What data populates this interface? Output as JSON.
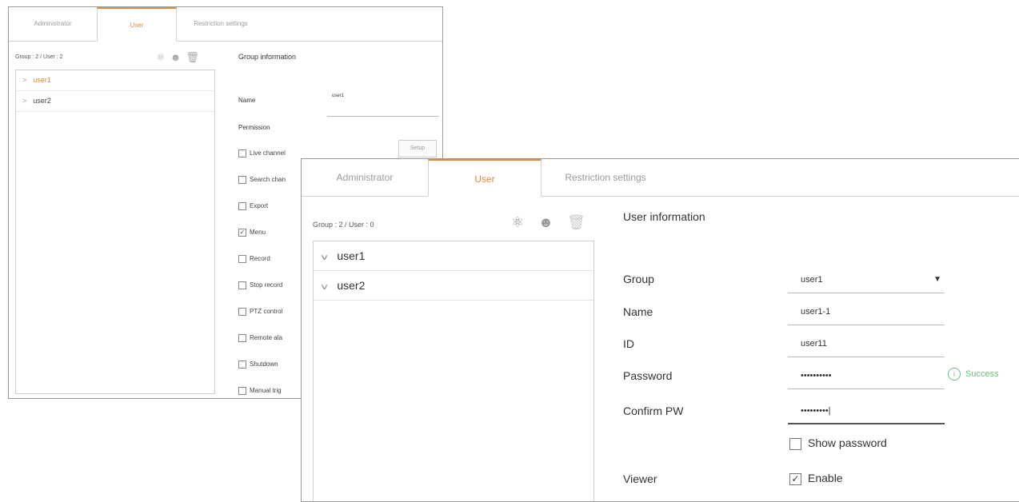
{
  "back_window": {
    "tabs": [
      "Administrator",
      "User",
      "Restriction settings"
    ],
    "counts": "Group : 2 / User : 2",
    "users": [
      "user1",
      "user2"
    ],
    "info_title": "Group information",
    "name_label": "Name",
    "name_value": "user1",
    "permission_label": "Permission",
    "setup_label": "Setup",
    "permissions": [
      {
        "label": "Live channel",
        "checked": false
      },
      {
        "label": "Search chan",
        "checked": false
      },
      {
        "label": "Export",
        "checked": false
      },
      {
        "label": "Menu",
        "checked": true
      },
      {
        "label": "Record",
        "checked": false
      },
      {
        "label": "Stop record",
        "checked": false
      },
      {
        "label": "PTZ control",
        "checked": false
      },
      {
        "label": "Remote ala",
        "checked": false
      },
      {
        "label": "Shutdown",
        "checked": false
      },
      {
        "label": "Manual trig",
        "checked": false
      }
    ]
  },
  "front_window": {
    "tabs": [
      "Administrator",
      "User",
      "Restriction settings"
    ],
    "counts": "Group : 2 / User : 0",
    "users": [
      "user1",
      "user2"
    ],
    "info_title": "User information",
    "fields": {
      "group_label": "Group",
      "group_value": "user1",
      "name_label": "Name",
      "name_value": "user1-1",
      "id_label": "ID",
      "id_value": "user11",
      "password_label": "Password",
      "password_value": "••••••••••",
      "confirm_label": "Confirm PW",
      "confirm_value": "•••••••••|"
    },
    "success_text": "Success",
    "show_password_label": "Show password",
    "viewer_label": "Viewer",
    "enable_label": "Enable"
  },
  "icons": {
    "add_group": "add-group-icon",
    "add_user": "add-user-icon",
    "delete": "trash-icon",
    "info": "info-icon"
  },
  "colors": {
    "accent": "#e08a3a",
    "success": "#6cbf7a"
  }
}
